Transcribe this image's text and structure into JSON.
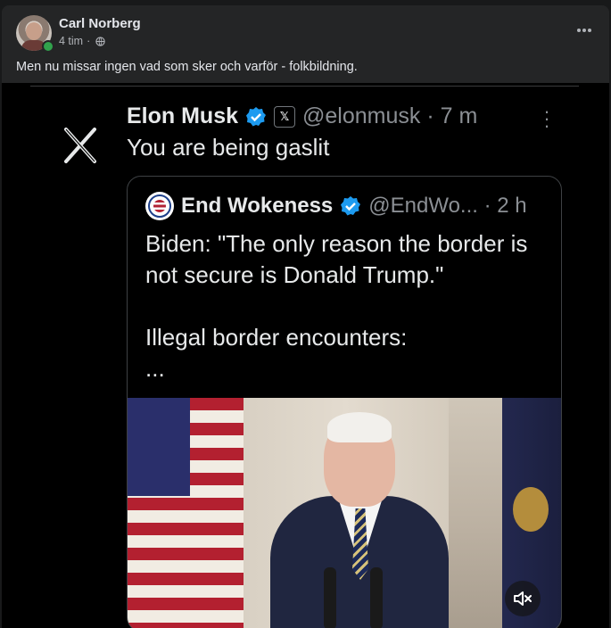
{
  "post": {
    "author": "Carl Norberg",
    "time": "4 tim",
    "separator": "·",
    "audience_icon": "globe-icon",
    "more_icon": "more-horizontal-icon",
    "text": "Men nu missar ingen vad som sker och varför - folkbildning."
  },
  "tweet": {
    "name": "Elon Musk",
    "badge_text": "𝕏",
    "handle": "@elonmusk · 7 m",
    "text": "You are being gaslit",
    "verified_color": "#1d9bf0",
    "quote": {
      "name": "End Wokeness",
      "handle": "@EndWo... · 2 h",
      "line1": "Biden: \"The only reason the border is",
      "line2": "not secure is Donald Trump.\"",
      "line3": "Illegal border encounters:",
      "line4": "..."
    }
  },
  "media": {
    "mute_icon": "volume-muted-icon"
  }
}
